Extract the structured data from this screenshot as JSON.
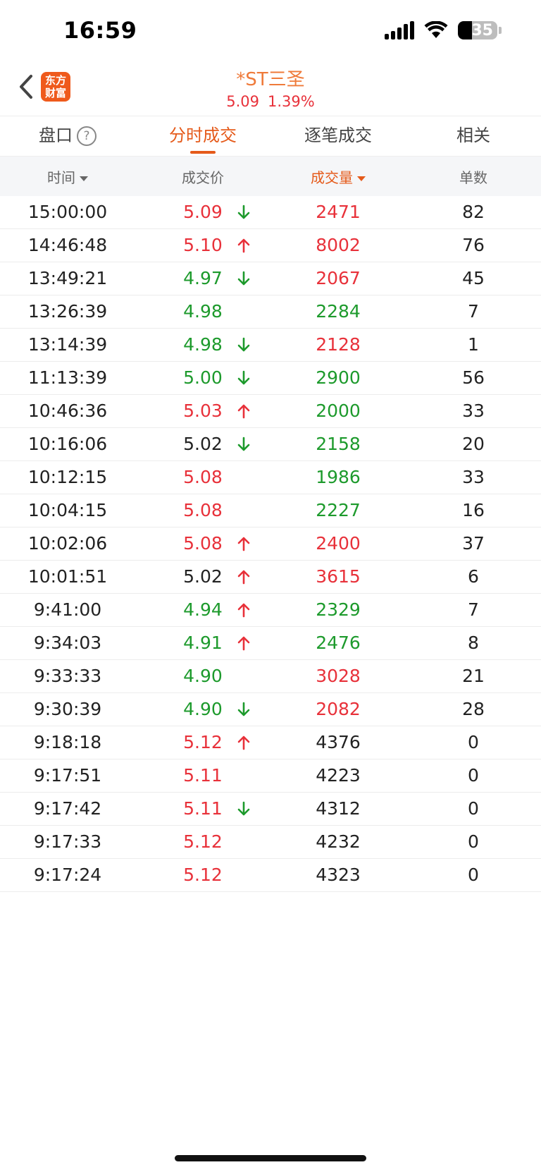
{
  "status_bar": {
    "time": "16:59",
    "battery": "35",
    "battery_level_percent": 35
  },
  "header": {
    "logo_line1": "东方",
    "logo_line2": "财富",
    "stock_name": "*ST三圣",
    "price": "5.09",
    "change_pct": "1.39%"
  },
  "tabs": [
    {
      "label": "盘口"
    },
    {
      "label": "分时成交"
    },
    {
      "label": "逐笔成交"
    },
    {
      "label": "相关"
    }
  ],
  "table": {
    "headers": {
      "time": "时间",
      "price": "成交价",
      "volume": "成交量",
      "count": "单数"
    },
    "rows": [
      {
        "time": "15:00:00",
        "price": "5.09",
        "price_color": "red",
        "arrow": "down",
        "volume": "2471",
        "volume_color": "red",
        "count": "82"
      },
      {
        "time": "14:46:48",
        "price": "5.10",
        "price_color": "red",
        "arrow": "up",
        "volume": "8002",
        "volume_color": "red",
        "count": "76"
      },
      {
        "time": "13:49:21",
        "price": "4.97",
        "price_color": "green",
        "arrow": "down",
        "volume": "2067",
        "volume_color": "red",
        "count": "45"
      },
      {
        "time": "13:26:39",
        "price": "4.98",
        "price_color": "green",
        "arrow": "",
        "volume": "2284",
        "volume_color": "green",
        "count": "7"
      },
      {
        "time": "13:14:39",
        "price": "4.98",
        "price_color": "green",
        "arrow": "down",
        "volume": "2128",
        "volume_color": "red",
        "count": "1"
      },
      {
        "time": "11:13:39",
        "price": "5.00",
        "price_color": "green",
        "arrow": "down",
        "volume": "2900",
        "volume_color": "green",
        "count": "56"
      },
      {
        "time": "10:46:36",
        "price": "5.03",
        "price_color": "red",
        "arrow": "up",
        "volume": "2000",
        "volume_color": "green",
        "count": "33"
      },
      {
        "time": "10:16:06",
        "price": "5.02",
        "price_color": "black",
        "arrow": "down",
        "volume": "2158",
        "volume_color": "green",
        "count": "20"
      },
      {
        "time": "10:12:15",
        "price": "5.08",
        "price_color": "red",
        "arrow": "",
        "volume": "1986",
        "volume_color": "green",
        "count": "33"
      },
      {
        "time": "10:04:15",
        "price": "5.08",
        "price_color": "red",
        "arrow": "",
        "volume": "2227",
        "volume_color": "green",
        "count": "16"
      },
      {
        "time": "10:02:06",
        "price": "5.08",
        "price_color": "red",
        "arrow": "up",
        "volume": "2400",
        "volume_color": "red",
        "count": "37"
      },
      {
        "time": "10:01:51",
        "price": "5.02",
        "price_color": "black",
        "arrow": "up",
        "volume": "3615",
        "volume_color": "red",
        "count": "6"
      },
      {
        "time": "9:41:00",
        "price": "4.94",
        "price_color": "green",
        "arrow": "up",
        "volume": "2329",
        "volume_color": "green",
        "count": "7"
      },
      {
        "time": "9:34:03",
        "price": "4.91",
        "price_color": "green",
        "arrow": "up",
        "volume": "2476",
        "volume_color": "green",
        "count": "8"
      },
      {
        "time": "9:33:33",
        "price": "4.90",
        "price_color": "green",
        "arrow": "",
        "volume": "3028",
        "volume_color": "red",
        "count": "21"
      },
      {
        "time": "9:30:39",
        "price": "4.90",
        "price_color": "green",
        "arrow": "down",
        "volume": "2082",
        "volume_color": "red",
        "count": "28"
      },
      {
        "time": "9:18:18",
        "price": "5.12",
        "price_color": "red",
        "arrow": "up",
        "volume": "4376",
        "volume_color": "black",
        "count": "0"
      },
      {
        "time": "9:17:51",
        "price": "5.11",
        "price_color": "red",
        "arrow": "",
        "volume": "4223",
        "volume_color": "black",
        "count": "0"
      },
      {
        "time": "9:17:42",
        "price": "5.11",
        "price_color": "red",
        "arrow": "down",
        "volume": "4312",
        "volume_color": "black",
        "count": "0"
      },
      {
        "time": "9:17:33",
        "price": "5.12",
        "price_color": "red",
        "arrow": "",
        "volume": "4232",
        "volume_color": "black",
        "count": "0"
      },
      {
        "time": "9:17:24",
        "price": "5.12",
        "price_color": "red",
        "arrow": "",
        "volume": "4323",
        "volume_color": "black",
        "count": "0"
      }
    ]
  },
  "colors": {
    "red": "#e8313a",
    "green": "#1d9a2c",
    "black": "#222222",
    "accent": "#e55a1a"
  }
}
